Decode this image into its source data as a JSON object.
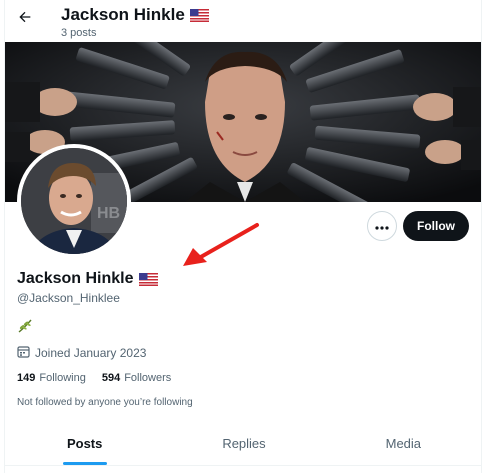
{
  "header": {
    "name": "Jackson Hinkle",
    "post_count": "3 posts"
  },
  "profile": {
    "display_name": "Jackson Hinkle",
    "handle": "@Jackson_Hinklee",
    "bio_icon": "olive-branch-emoji",
    "joined": "Joined January 2023",
    "following_count": "149",
    "following_label": "Following",
    "followers_count": "594",
    "followers_label": "Followers",
    "followed_note": "Not followed by anyone you’re following"
  },
  "actions": {
    "follow_label": "Follow",
    "more_icon": "more-options-icon"
  },
  "tabs": [
    {
      "label": "Posts",
      "active": true
    },
    {
      "label": "Replies",
      "active": false
    },
    {
      "label": "Media",
      "active": false
    }
  ],
  "colors": {
    "accent": "#1d9bf0",
    "text": "#0f1419",
    "secondary": "#536471",
    "annotation_arrow": "#e8211c"
  }
}
